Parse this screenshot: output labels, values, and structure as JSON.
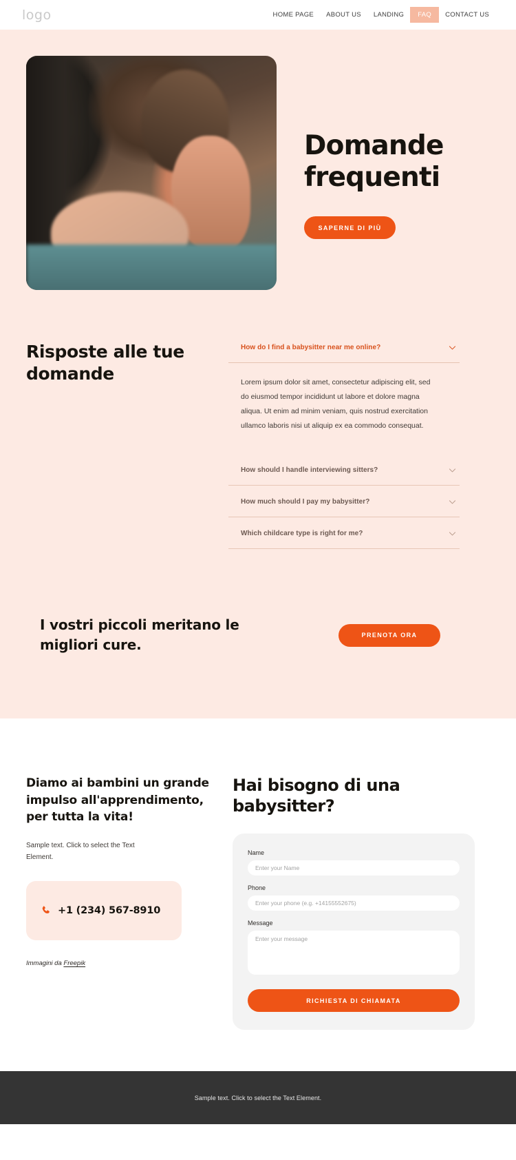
{
  "header": {
    "logo": "logo",
    "nav": [
      {
        "label": "HOME PAGE",
        "active": false
      },
      {
        "label": "ABOUT US",
        "active": false
      },
      {
        "label": "LANDING",
        "active": false
      },
      {
        "label": "FAQ",
        "active": true
      },
      {
        "label": "CONTACT US",
        "active": false
      }
    ]
  },
  "hero": {
    "title": "Domande frequenti",
    "button": "SAPERNE DI PIÙ",
    "image_alt": "mother-playing-with-baby-photo"
  },
  "faq": {
    "heading": "Risposte alle tue domande",
    "items": [
      {
        "question": "How do I find a babysitter near me online?",
        "answer": "Lorem ipsum dolor sit amet, consectetur adipiscing elit, sed do eiusmod tempor incididunt ut labore et dolore magna aliqua. Ut enim ad minim veniam, quis nostrud exercitation ullamco laboris nisi ut aliquip ex ea commodo consequat.",
        "open": true
      },
      {
        "question": "How should I handle interviewing sitters?",
        "answer": "",
        "open": false
      },
      {
        "question": "How much should I pay my babysitter?",
        "answer": "",
        "open": false
      },
      {
        "question": "Which childcare type is right for me?",
        "answer": "",
        "open": false
      }
    ]
  },
  "cta": {
    "text": "I vostri piccoli meritano le migliori cure.",
    "button": "PRENOTA ORA"
  },
  "contact": {
    "heading": "Diamo ai bambini un grande impulso all'apprendimento, per tutta la vita!",
    "subtext": "Sample text. Click to select the Text Element.",
    "phone": "+1 (234) 567-8910",
    "credit_prefix": "Immagini da ",
    "credit_link": "Freepik"
  },
  "form": {
    "title": "Hai bisogno di una babysitter?",
    "fields": [
      {
        "label": "Name",
        "placeholder": "Enter your Name",
        "value": "",
        "type": "text"
      },
      {
        "label": "Phone",
        "placeholder": "Enter your phone (e.g. +14155552675)",
        "value": "",
        "type": "text"
      },
      {
        "label": "Message",
        "placeholder": "Enter your message",
        "value": "",
        "type": "textarea"
      }
    ],
    "submit": "RICHIESTA DI CHIAMATA"
  },
  "footer": {
    "text": "Sample text. Click to select the Text Element."
  },
  "colors": {
    "accent_orange": "#ee5416",
    "peach_bg": "#fdeae3",
    "nav_active_bg": "#f6b9a0",
    "question_open": "#d8511c",
    "question_closed": "#6d5a52",
    "footer_bg": "#343434"
  }
}
